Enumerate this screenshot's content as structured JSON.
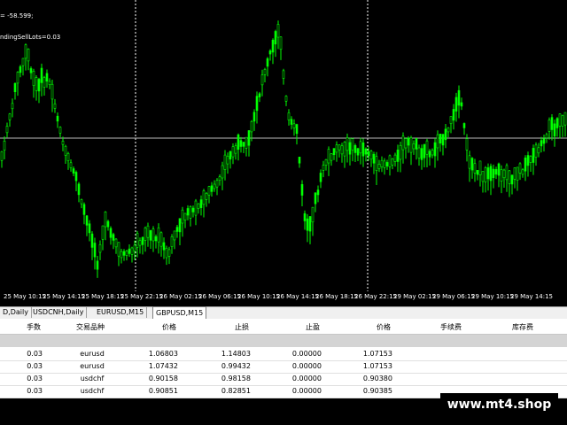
{
  "indicators": {
    "line1": "= -58.599;",
    "line2": "ndingSellLots=0.03"
  },
  "time_labels": [
    "25 May 10:15",
    "25 May 14:15",
    "25 May 18:15",
    "25 May 22:15",
    "26 May 02:15",
    "26 May 06:15",
    "26 May 10:15",
    "26 May 14:15",
    "26 May 18:15",
    "26 May 22:15",
    "29 May 02:15",
    "29 May 06:15",
    "29 May 10:15",
    "29 May 14:15"
  ],
  "tabs": [
    {
      "label": "D,Daily",
      "active": false
    },
    {
      "label": "USDCNH,Daily",
      "active": false
    },
    {
      "label": "EURUSD,M15",
      "active": false
    },
    {
      "label": "GBPUSD,M15",
      "active": true
    }
  ],
  "orders": {
    "headers": [
      "手数",
      "交易品种",
      "价格",
      "止损",
      "止盈",
      "价格",
      "手续费",
      "库存费"
    ],
    "rows": [
      [
        "0.03",
        "eurusd",
        "1.06803",
        "1.14803",
        "0.00000",
        "1.07153"
      ],
      [
        "0.03",
        "eurusd",
        "1.07432",
        "0.99432",
        "0.00000",
        "1.07153"
      ],
      [
        "0.03",
        "usdchf",
        "0.90158",
        "0.98158",
        "0.00000",
        "0.90380"
      ],
      [
        "0.03",
        "usdchf",
        "0.90851",
        "0.82851",
        "0.00000",
        "0.90385"
      ]
    ]
  },
  "watermark": "www.mt4.shop",
  "colors": {
    "candle": "#00ff00",
    "background": "#000000",
    "grid": "#ffffff"
  }
}
